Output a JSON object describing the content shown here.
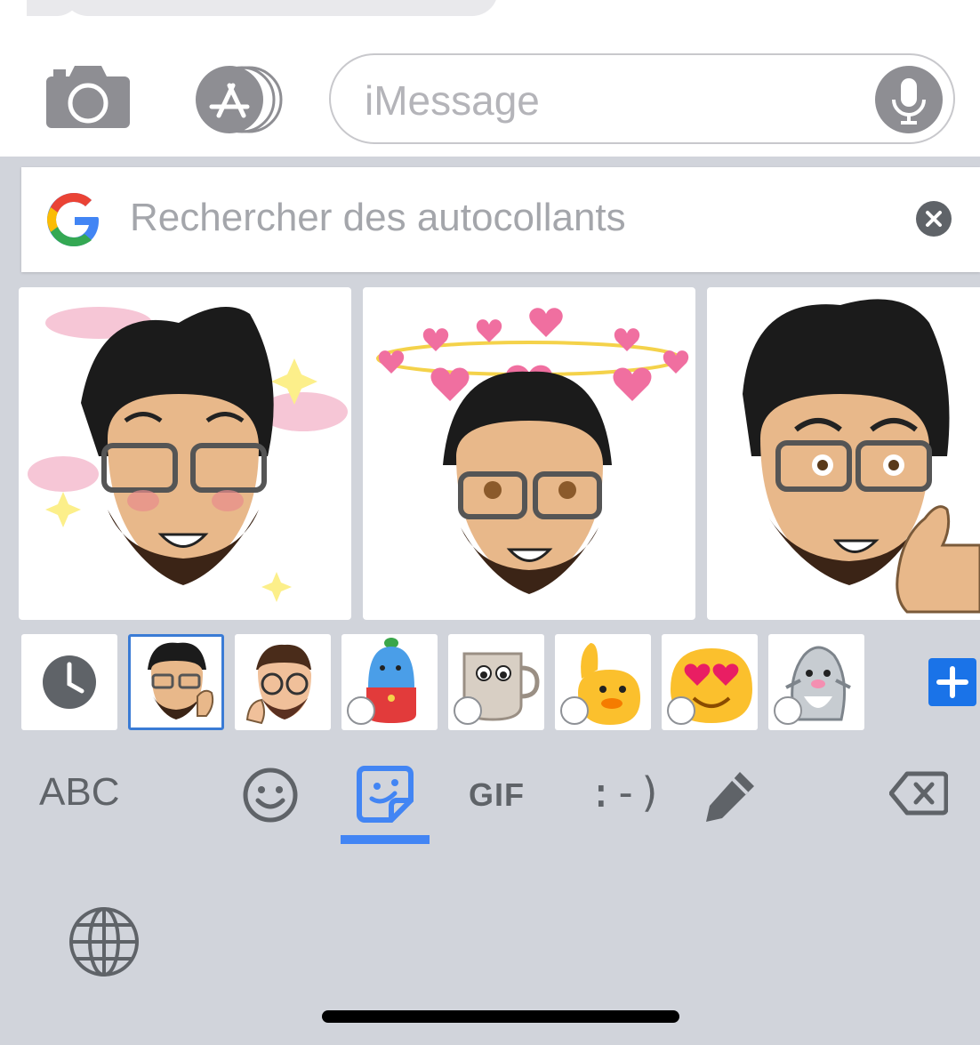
{
  "compose": {
    "placeholder": "iMessage",
    "camera_icon": "camera-icon",
    "appstore_icon": "app-store-icon",
    "mic_icon": "microphone-icon"
  },
  "keyboard": {
    "search": {
      "placeholder": "Rechercher des autocollants",
      "logo": "google-logo",
      "clear_icon": "clear-icon"
    },
    "stickers": [
      {
        "name": "sticker-sleepy-blush",
        "description_icon": "avatar-sticker"
      },
      {
        "name": "sticker-hearts-halo",
        "description_icon": "avatar-sticker"
      },
      {
        "name": "sticker-thumbs-up",
        "description_icon": "avatar-sticker"
      }
    ],
    "packs": [
      {
        "name": "recent",
        "icon": "clock-icon"
      },
      {
        "name": "avatar-pack-1",
        "icon": "avatar-icon"
      },
      {
        "name": "avatar-pack-2",
        "icon": "avatar-icon"
      },
      {
        "name": "blue-creature",
        "icon": "creature-icon",
        "animated": true
      },
      {
        "name": "coffee-cup",
        "icon": "cup-icon",
        "animated": true
      },
      {
        "name": "blob-wave",
        "icon": "blob-icon",
        "animated": true
      },
      {
        "name": "blob-heart-eyes",
        "icon": "blob-icon",
        "animated": true
      },
      {
        "name": "shark",
        "icon": "shark-icon",
        "animated": true
      }
    ],
    "modes": {
      "abc": "ABC",
      "gif": "GIF",
      "emoticon": ":-)",
      "active": "stickers"
    },
    "colors": {
      "accent": "#4285f4",
      "keyboard_bg": "#d1d4db",
      "icon_gray": "#5f6368"
    }
  }
}
